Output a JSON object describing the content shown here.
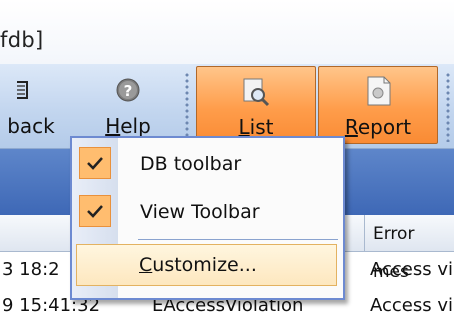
{
  "window": {
    "title_fragment": "fdb]"
  },
  "toolbar": {
    "buttons": [
      {
        "label": "back",
        "icon": "rollback-icon",
        "underline": ""
      },
      {
        "label_u": "H",
        "label_rest": "elp",
        "icon": "help-icon"
      },
      {
        "label_u": "L",
        "label_rest": "ist",
        "icon": "list-icon",
        "active": true
      },
      {
        "label_u": "R",
        "label_rest": "eport",
        "icon": "report-icon",
        "active": true
      }
    ]
  },
  "grid": {
    "header": {
      "column_partial": "Error mes"
    },
    "rows": [
      {
        "col1": "3 18:2",
        "col3": "Access vi"
      },
      {
        "col1": "9 15:41:32",
        "col2": "EAccessViolation",
        "col3": "Access vi"
      }
    ]
  },
  "context_menu": {
    "items": [
      {
        "label": "DB toolbar",
        "checked": true
      },
      {
        "label": "View Toolbar",
        "checked": true
      },
      {
        "label_u": "C",
        "label_rest": "ustomize...",
        "highlighted": true
      }
    ]
  },
  "colors": {
    "accent_orange": "#ff9d4b",
    "menu_border": "#6d8ad1",
    "highlight_bg": "#fde7bf",
    "band_blue": "#4a74bf"
  }
}
